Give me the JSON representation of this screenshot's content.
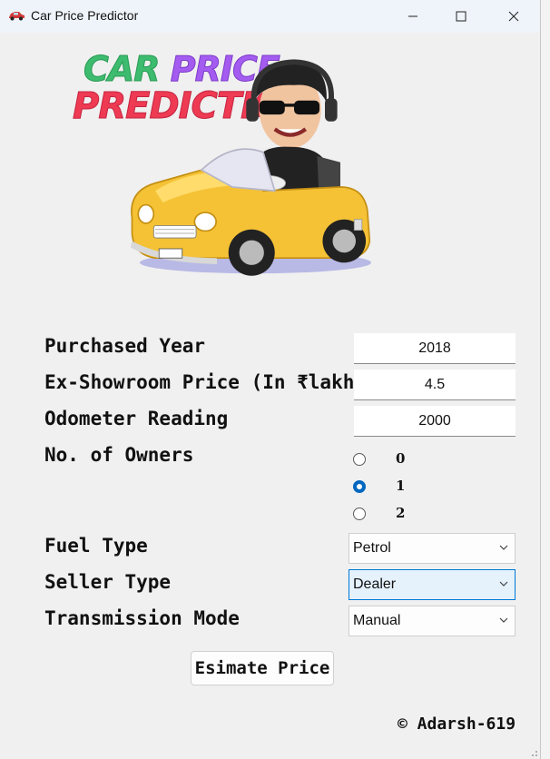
{
  "window": {
    "title": "Car Price Predictor",
    "controls": {
      "minimize": "–",
      "maximize": "☐",
      "close": "✕"
    }
  },
  "logo": {
    "line1_word1": "CAR",
    "line1_word2": "PRICE",
    "line2": "PREDICTION",
    "colors": {
      "car": "#3dbb6e",
      "price": "#a45cf0",
      "prediction": "#ef3a53",
      "car_body": "#f5c236"
    }
  },
  "form": {
    "purchased_year": {
      "label": "Purchased Year",
      "value": "2018"
    },
    "ex_showroom_price": {
      "label": "Ex-Showroom Price (In ₹lakhs)",
      "value": "4.5"
    },
    "odometer_reading": {
      "label": "Odometer Reading",
      "value": "2000"
    },
    "owners": {
      "label": "No. of Owners",
      "options": [
        "0",
        "1",
        "2"
      ],
      "selected": "1"
    },
    "fuel_type": {
      "label": "Fuel Type",
      "value": "Petrol"
    },
    "seller_type": {
      "label": "Seller Type",
      "value": "Dealer"
    },
    "transmission_mode": {
      "label": "Transmission Mode",
      "value": "Manual"
    }
  },
  "estimate_button": "Esimate Price",
  "copyright": "© Adarsh-619",
  "icons": {
    "app": "car-icon",
    "dropdown": "chevron-down-icon"
  }
}
